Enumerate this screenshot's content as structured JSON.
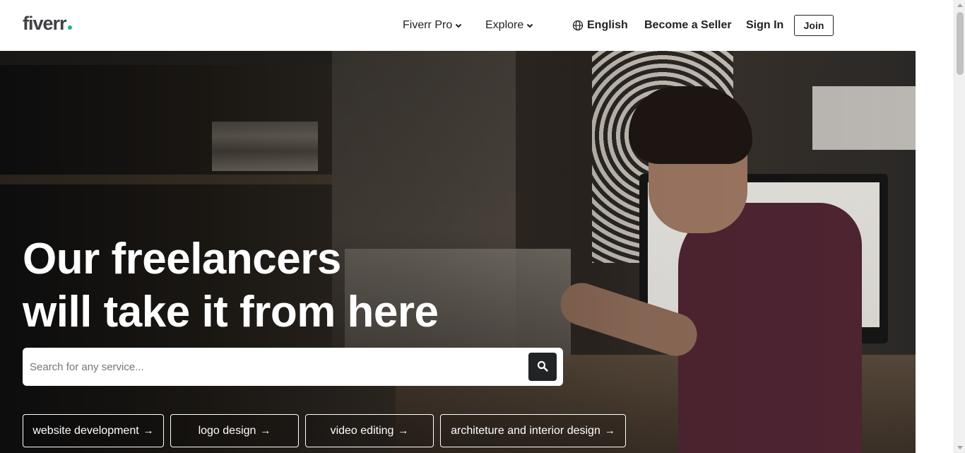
{
  "header": {
    "logo_text": "fiverr",
    "logo_dot_color": "#1dbf73",
    "nav": {
      "fiverr_pro": "Fiverr Pro",
      "explore": "Explore",
      "language": "English",
      "become_seller": "Become a Seller",
      "sign_in": "Sign In",
      "join": "Join"
    },
    "icons": {
      "chevron": "chevron-down-icon",
      "globe": "globe-icon"
    }
  },
  "hero": {
    "headline_line1": "Our freelancers",
    "headline_line2": "will take it from here",
    "search": {
      "placeholder": "Search for any service...",
      "value": "",
      "button_icon": "search-icon"
    },
    "chips": [
      {
        "label": "website development",
        "arrow": "→"
      },
      {
        "label": "logo design",
        "arrow": "→"
      },
      {
        "label": "video editing",
        "arrow": "→"
      },
      {
        "label": "architeture and interior design",
        "arrow": "→"
      }
    ]
  }
}
